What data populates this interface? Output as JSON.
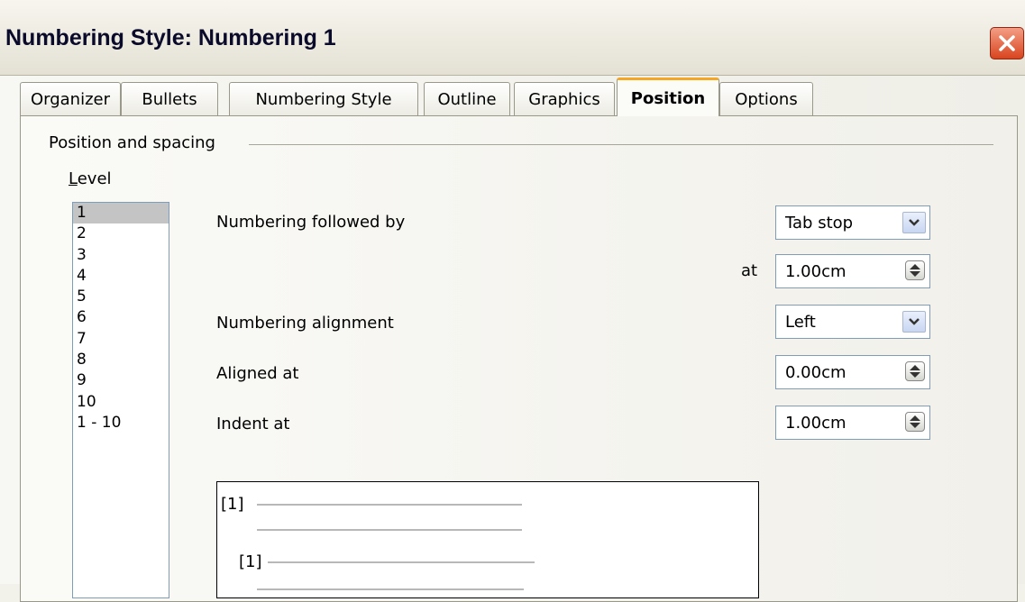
{
  "window": {
    "title": "Numbering Style: Numbering 1"
  },
  "tabs": [
    {
      "label": "Organizer",
      "active": false
    },
    {
      "label": "Bullets",
      "active": false
    },
    {
      "label": "Numbering Style",
      "active": false
    },
    {
      "label": "Outline",
      "active": false
    },
    {
      "label": "Graphics",
      "active": false
    },
    {
      "label": "Position",
      "active": true
    },
    {
      "label": "Options",
      "active": false
    }
  ],
  "group": {
    "label": "Position and spacing",
    "level_label": "Level",
    "levels": [
      "1",
      "2",
      "3",
      "4",
      "5",
      "6",
      "7",
      "8",
      "9",
      "10",
      "1 - 10"
    ],
    "selected_level": "1"
  },
  "fields": {
    "numbering_followed_by": {
      "label": "Numbering followed by",
      "value": "Tab stop"
    },
    "at": {
      "label": "at",
      "value": "1.00cm"
    },
    "numbering_alignment": {
      "label": "Numbering alignment",
      "value": "Left"
    },
    "aligned_at": {
      "label": "Aligned at",
      "value": "0.00cm"
    },
    "indent_at": {
      "label": "Indent at",
      "value": "1.00cm"
    }
  },
  "preview": {
    "level1_marker": "[1]",
    "level2_marker": "[1]"
  },
  "icons": {
    "close": "close-icon",
    "dropdown": "chevron-down-icon",
    "spin": "spin-arrows-icon"
  },
  "colors": {
    "active_tab_accent": "#f5a623",
    "close_button": "#d9441e",
    "selection": "#c4c4c4"
  }
}
